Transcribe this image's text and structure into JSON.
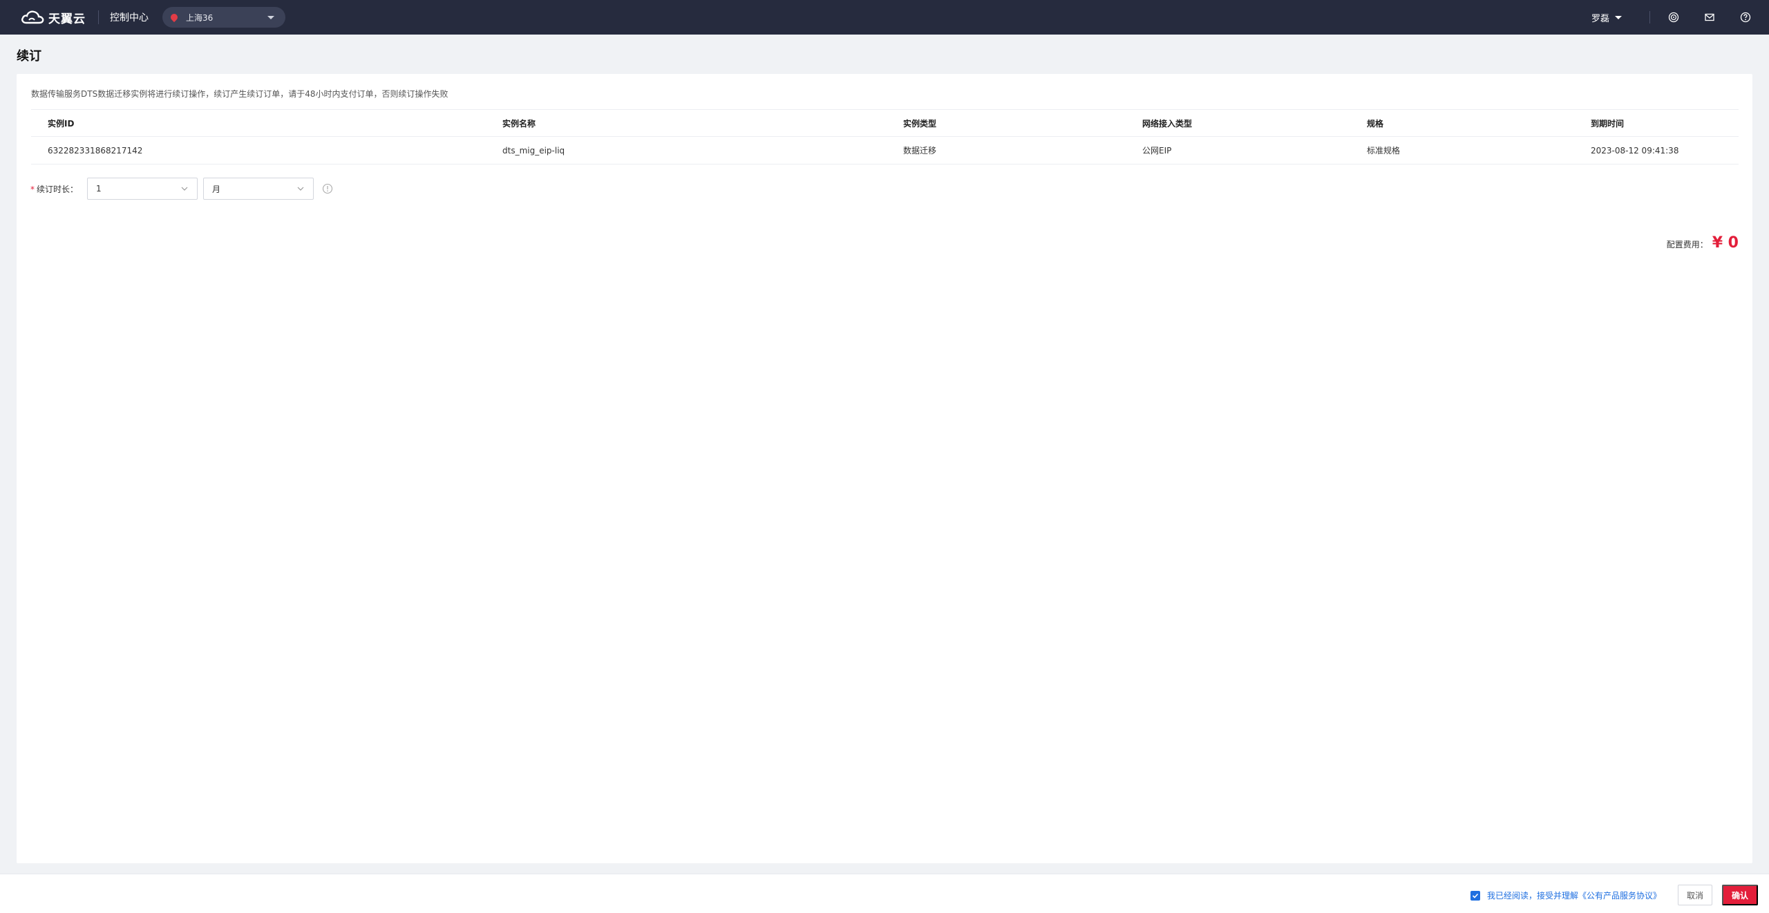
{
  "header": {
    "logo_text": "天翼云",
    "console_label": "控制中心",
    "region": "上海36",
    "user_name": "罗磊",
    "icons": [
      "target-icon",
      "mail-icon",
      "help-icon"
    ]
  },
  "page": {
    "title": "续订"
  },
  "notice": "数据传输服务DTS数据迁移实例将进行续订操作，续订产生续订订单，请于48小时内支付订单，否则续订操作失败",
  "table": {
    "headers": [
      "实例ID",
      "实例名称",
      "实例类型",
      "网络接入类型",
      "规格",
      "到期时间"
    ],
    "rows": [
      [
        "632282331868217142",
        "dts_mig_eip-liq",
        "数据迁移",
        "公网EIP",
        "标准规格",
        "2023-08-12 09:41:38"
      ]
    ]
  },
  "renewal": {
    "label": "续订时长：",
    "required_mark": "*",
    "duration_value": "1",
    "unit_value": "月"
  },
  "fee": {
    "label": "配置费用：",
    "value": "¥ 0"
  },
  "footer": {
    "agreement_text": "我已经阅读，接受并理解《公有产品服务协议》",
    "agreement_checked": true,
    "cancel_label": "取消",
    "confirm_label": "确认"
  },
  "colors": {
    "topbar": "#262b3e",
    "accent_red": "#e31e3a",
    "link_blue": "#1f6fe0"
  }
}
